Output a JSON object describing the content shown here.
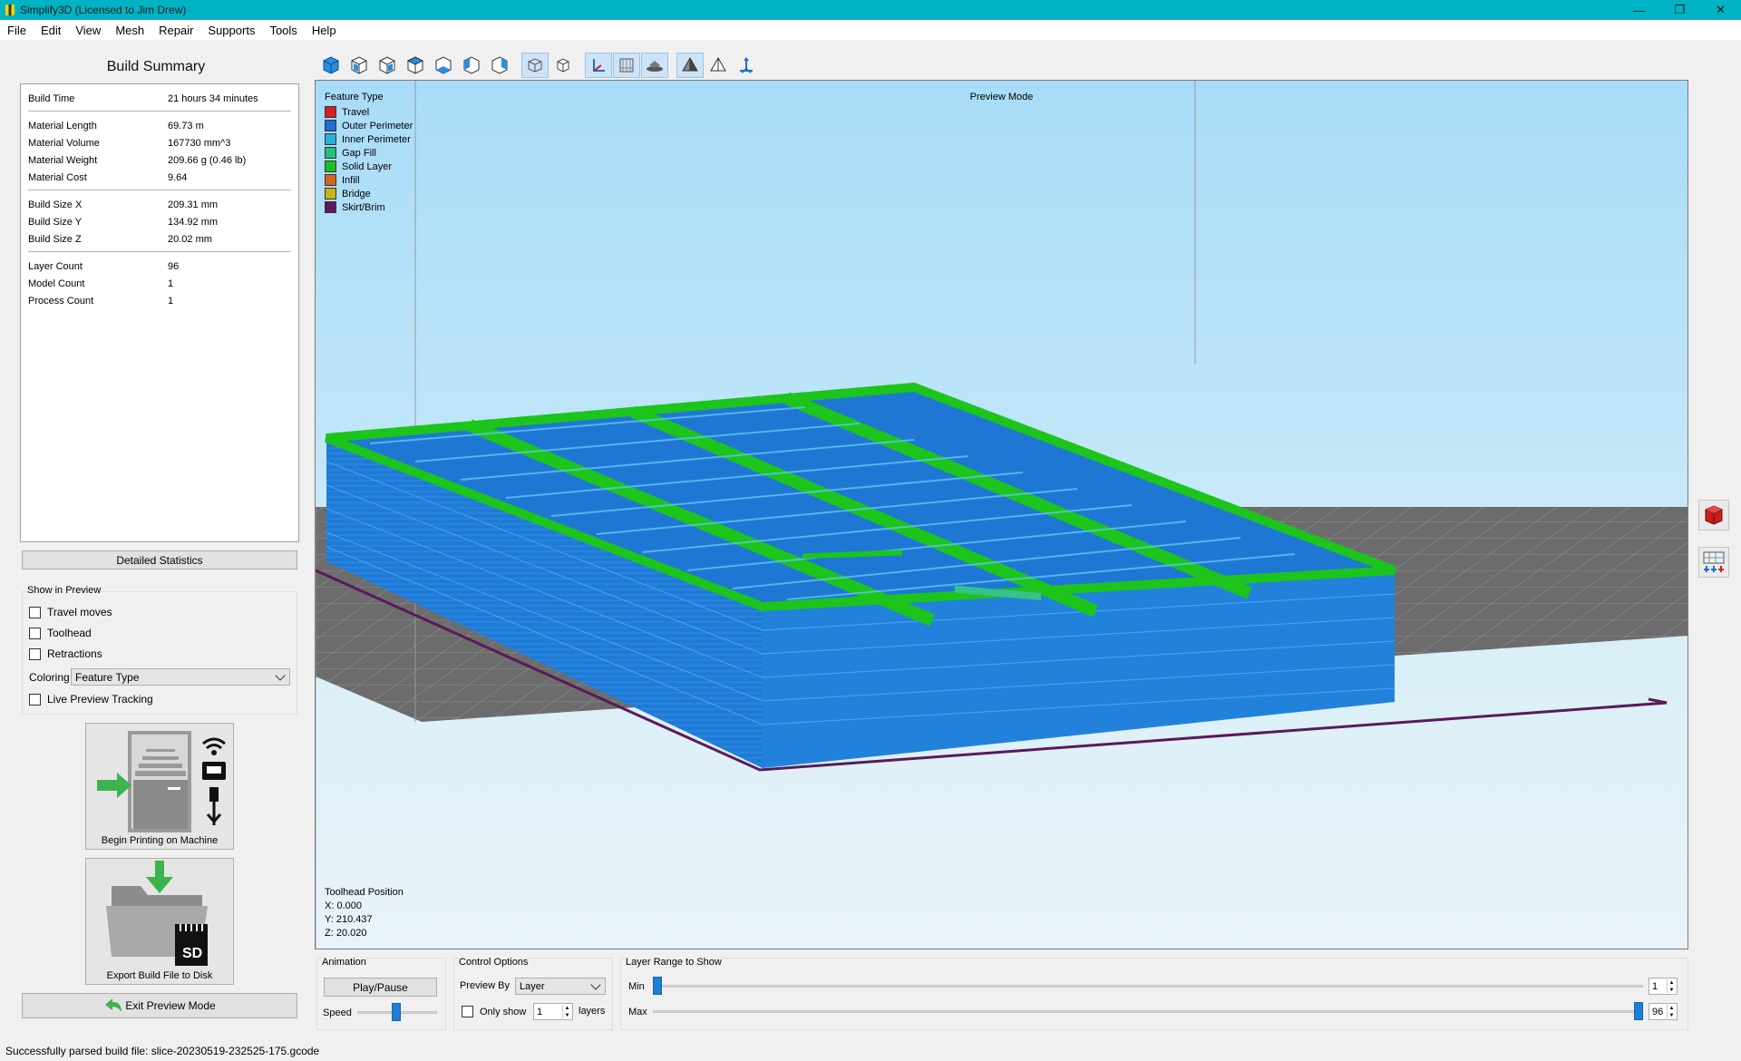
{
  "window": {
    "title": "Simplify3D (Licensed to Jim Drew)"
  },
  "menu": [
    "File",
    "Edit",
    "View",
    "Mesh",
    "Repair",
    "Supports",
    "Tools",
    "Help"
  ],
  "summary": {
    "title": "Build Summary",
    "groups": [
      [
        {
          "label": "Build Time",
          "value": "21 hours 34 minutes"
        }
      ],
      [
        {
          "label": "Material Length",
          "value": "69.73 m"
        },
        {
          "label": "Material Volume",
          "value": "167730 mm^3"
        },
        {
          "label": "Material Weight",
          "value": "209.66 g (0.46 lb)"
        },
        {
          "label": "Material Cost",
          "value": "9.64"
        }
      ],
      [
        {
          "label": "Build Size X",
          "value": "209.31 mm"
        },
        {
          "label": "Build Size Y",
          "value": "134.92 mm"
        },
        {
          "label": "Build Size Z",
          "value": "20.02 mm"
        }
      ],
      [
        {
          "label": "Layer Count",
          "value": "96"
        },
        {
          "label": "Model Count",
          "value": "1"
        },
        {
          "label": "Process Count",
          "value": "1"
        }
      ]
    ]
  },
  "detailed_stats_label": "Detailed Statistics",
  "show_in_preview": {
    "title": "Show in Preview",
    "travel_moves": "Travel moves",
    "toolhead": "Toolhead",
    "retractions": "Retractions",
    "coloring_label": "Coloring",
    "coloring_value": "Feature Type",
    "live_tracking": "Live Preview Tracking"
  },
  "begin_printing_label": "Begin Printing on Machine",
  "export_label": "Export Build File to Disk",
  "sd_label": "SD",
  "exit_preview_label": "Exit Preview Mode",
  "viewport": {
    "preview_mode": "Preview Mode",
    "legend_title": "Feature Type",
    "legend": [
      {
        "label": "Travel",
        "color": "#d42020"
      },
      {
        "label": "Outer Perimeter",
        "color": "#1a6fd0"
      },
      {
        "label": "Inner Perimeter",
        "color": "#2ab0d8"
      },
      {
        "label": "Gap Fill",
        "color": "#26c07a"
      },
      {
        "label": "Solid Layer",
        "color": "#1fbf1f"
      },
      {
        "label": "Infill",
        "color": "#d2691e"
      },
      {
        "label": "Bridge",
        "color": "#c9b21a"
      },
      {
        "label": "Skirt/Brim",
        "color": "#5a1a5a"
      }
    ],
    "toolhead_title": "Toolhead Position",
    "x": "X: 0.000",
    "y": "Y: 210.437",
    "z": "Z: 20.020"
  },
  "animation": {
    "title": "Animation",
    "play_label": "Play/Pause",
    "speed_label": "Speed"
  },
  "control": {
    "title": "Control Options",
    "preview_by_label": "Preview By",
    "preview_by_value": "Layer",
    "only_show_label": "Only show",
    "only_show_value": "1",
    "layers_label": "layers"
  },
  "layer_range": {
    "title": "Layer Range to Show",
    "min_label": "Min",
    "max_label": "Max",
    "min_value": "1",
    "max_value": "96"
  },
  "status": "Successfully parsed build file: slice-20230519-232525-175.gcode"
}
